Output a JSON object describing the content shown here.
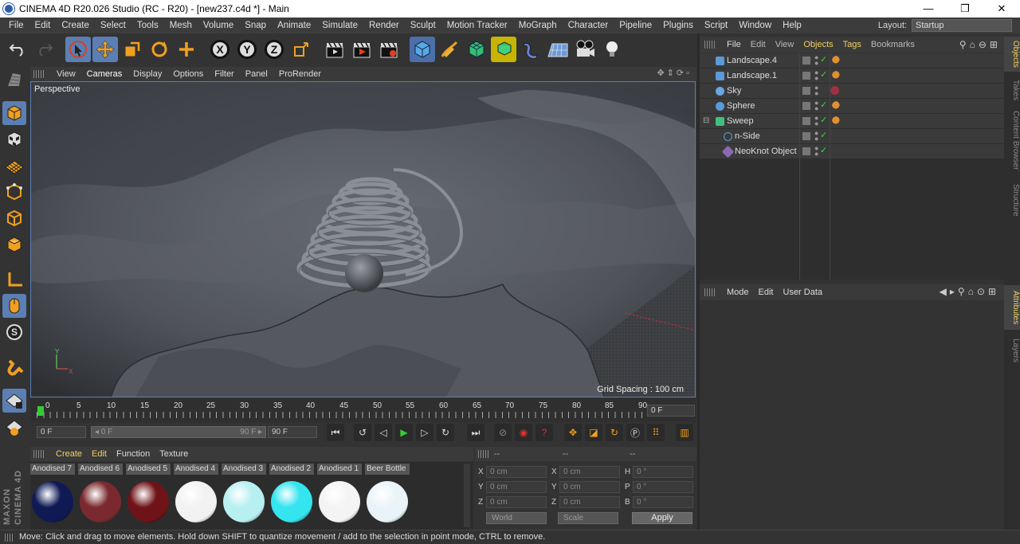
{
  "window": {
    "title": "CINEMA 4D R20.026 Studio (RC - R20) - [new237.c4d *] - Main",
    "minimize": "—",
    "restore": "❐",
    "close": "✕"
  },
  "menubar": {
    "items": [
      "File",
      "Edit",
      "Create",
      "Select",
      "Tools",
      "Mesh",
      "Volume",
      "Snap",
      "Animate",
      "Simulate",
      "Render",
      "Sculpt",
      "Motion Tracker",
      "MoGraph",
      "Character",
      "Pipeline",
      "Plugins",
      "Script",
      "Window",
      "Help"
    ],
    "layout_label": "Layout:",
    "layout_value": "Startup"
  },
  "toolbar": {
    "axis_x": "X",
    "axis_y": "Y",
    "axis_z": "Z"
  },
  "viewport": {
    "menu": [
      "View",
      "Cameras",
      "Display",
      "Options",
      "Filter",
      "Panel",
      "ProRender"
    ],
    "camera_label": "Perspective",
    "grid_spacing": "Grid Spacing : 100 cm"
  },
  "timeline": {
    "ticks": [
      "0",
      "5",
      "10",
      "15",
      "20",
      "25",
      "30",
      "35",
      "40",
      "45",
      "50",
      "55",
      "60",
      "65",
      "70",
      "75",
      "80",
      "85",
      "90"
    ],
    "current_frame": "0 F"
  },
  "transport": {
    "start_field": "0 F",
    "range_start": "◂ 0 F",
    "range_end": "90 F ▸",
    "end_field": "90 F"
  },
  "materials": {
    "menu": [
      "Create",
      "Edit",
      "Function",
      "Texture"
    ],
    "items": [
      {
        "name": "Anodised 7",
        "color": "#0f1a55"
      },
      {
        "name": "Anodised 6",
        "color": "#7a2a2e"
      },
      {
        "name": "Anodised 5",
        "color": "#6e1418"
      },
      {
        "name": "Anodised 4",
        "color": "#f2f2f2"
      },
      {
        "name": "Anodised 3",
        "color": "#b8f0f2"
      },
      {
        "name": "Anodised 2",
        "color": "#34e4ee"
      },
      {
        "name": "Anodised 1",
        "color": "#f4f4f4"
      },
      {
        "name": "Beer Bottle",
        "color": "#eaf4f8"
      }
    ]
  },
  "coordinates": {
    "hdr1": "--",
    "hdr2": "--",
    "hdr3": "--",
    "rows": [
      {
        "a": "X",
        "av": "0 cm",
        "b": "X",
        "bv": "0 cm",
        "c": "H",
        "cv": "0 °"
      },
      {
        "a": "Y",
        "av": "0 cm",
        "b": "Y",
        "bv": "0 cm",
        "c": "P",
        "cv": "0 °"
      },
      {
        "a": "Z",
        "av": "0 cm",
        "b": "Z",
        "bv": "0 cm",
        "c": "B",
        "cv": "0 °"
      }
    ],
    "space_dropdown": "World",
    "mode_dropdown": "Scale",
    "apply": "Apply"
  },
  "objects": {
    "menu": [
      "File",
      "Edit",
      "View",
      "Objects",
      "Tags",
      "Bookmarks"
    ],
    "items": [
      {
        "name": "Landscape.4",
        "icon_color": "#5a9ad8",
        "tag_color": "#e09030",
        "indent": 0
      },
      {
        "name": "Landscape.1",
        "icon_color": "#5a9ad8",
        "tag_color": "#e09030",
        "indent": 0
      },
      {
        "name": "Sky",
        "icon_color": "#6aa6e0",
        "tag_color": "#a03040",
        "indent": 0
      },
      {
        "name": "Sphere",
        "icon_color": "#5a9ad8",
        "tag_color": "#e09030",
        "indent": 0
      },
      {
        "name": "Sweep",
        "icon_color": "#40c080",
        "tag_color": "#e09030",
        "indent": 0
      },
      {
        "name": "n-Side",
        "icon_color": "#5a9ad8",
        "tag_color": "",
        "indent": 1
      },
      {
        "name": "NeoKnot Object",
        "icon_color": "#8a6ab0",
        "tag_color": "",
        "indent": 1
      }
    ]
  },
  "side_tabs": [
    "Objects",
    "Takes",
    "Content Browser",
    "Structure",
    "Attributes",
    "Layers"
  ],
  "attributes": {
    "menu": [
      "Mode",
      "Edit",
      "User Data"
    ]
  },
  "status": {
    "text": "Move: Click and drag to move elements. Hold down SHIFT to quantize movement / add to the selection in point mode, CTRL to remove."
  },
  "branding": {
    "text": "MAXON CINEMA 4D"
  }
}
